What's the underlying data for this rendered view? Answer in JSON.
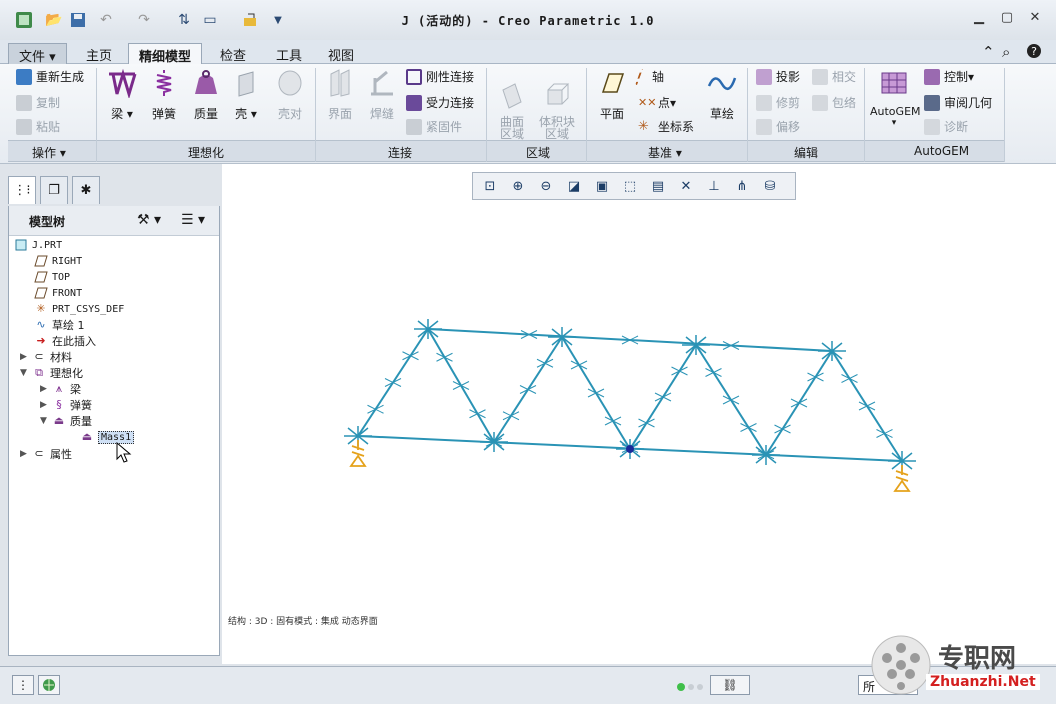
{
  "window": {
    "title": "J (活动的) - Creo Parametric 1.0"
  },
  "menubar": {
    "tabs": [
      "文件",
      "主页",
      "精细模型",
      "检查",
      "工具",
      "视图"
    ],
    "active_tab": "精细模型"
  },
  "ribbon": {
    "operations": {
      "regenerate": "重新生成",
      "copy": "复制",
      "paste": "粘贴",
      "group_label": "操作"
    },
    "idealization": {
      "beam": "梁",
      "spring": "弹簧",
      "mass": "质量",
      "shell": "壳",
      "shell_pair": "壳对",
      "group_label": "理想化"
    },
    "connection": {
      "interface": "界面",
      "weld": "焊缝",
      "rigid_link": "刚性连接",
      "weighted_link": "受力连接",
      "fastener": "紧固件",
      "group_label": "连接"
    },
    "region": {
      "surface_region": "曲面\n区域",
      "volume_region": "体积块\n区域",
      "group_label": "区域"
    },
    "datum": {
      "plane": "平面",
      "axis": "轴",
      "point": "点",
      "csys": "坐标系",
      "sketch": "草绘",
      "group_label": "基准"
    },
    "editing": {
      "project": "投影",
      "intersect": "相交",
      "trim": "修剪",
      "wrap": "包络",
      "offset": "偏移",
      "group_label": "编辑"
    },
    "autogem": {
      "autogem": "AutoGEM",
      "control": "控制",
      "review_geometry": "审阅几何",
      "diagnose": "诊断",
      "group_label": "AutoGEM"
    }
  },
  "model_tree": {
    "title": "模型树",
    "items": [
      {
        "label": "J.PRT"
      },
      {
        "label": "RIGHT"
      },
      {
        "label": "TOP"
      },
      {
        "label": "FRONT"
      },
      {
        "label": "PRT_CSYS_DEF"
      },
      {
        "label": "草绘 1"
      },
      {
        "label": "在此插入"
      },
      {
        "label": "材料"
      },
      {
        "label": "理想化"
      },
      {
        "label": "梁"
      },
      {
        "label": "弹簧"
      },
      {
        "label": "质量"
      },
      {
        "label": "Mass1"
      },
      {
        "label": "属性"
      }
    ]
  },
  "graphics": {
    "view_info": "结构 : 3D : 固有模式 : 集成 动态界面",
    "beam_color": "#2a93b5",
    "constraint_color": "#e5a21b"
  },
  "statusbar": {
    "filter_text": "所"
  },
  "watermark": {
    "brand": "专职网",
    "url": "Zhuanzhi.Net"
  }
}
